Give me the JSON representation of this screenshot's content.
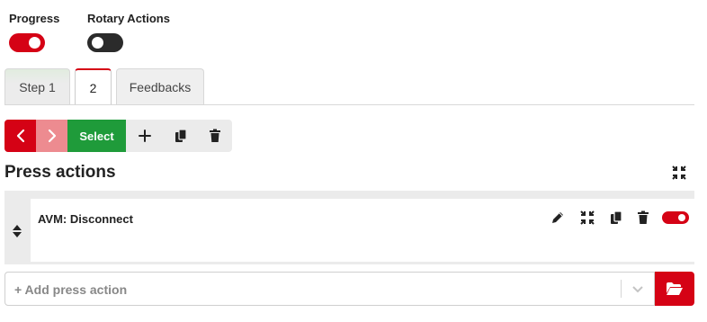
{
  "toggles": {
    "progress": {
      "label": "Progress",
      "enabled": true
    },
    "rotary_actions": {
      "label": "Rotary Actions",
      "enabled": false
    }
  },
  "tabs": [
    {
      "label": "Step 1",
      "active": false
    },
    {
      "label": "2",
      "active": true
    },
    {
      "label": "Feedbacks",
      "active": false
    }
  ],
  "step_toolbar": {
    "prev_icon": "chevron-left-icon",
    "next_icon": "chevron-right-icon",
    "select_label": "Select",
    "add_icon": "plus-icon",
    "copy_icon": "copy-icon",
    "delete_icon": "trash-icon"
  },
  "press_actions": {
    "title": "Press actions",
    "collapse_icon": "compress-icon",
    "items": [
      {
        "name": "AVM: Disconnect",
        "enabled": true,
        "icons": [
          "pencil-icon",
          "compress-icon",
          "copy-icon",
          "trash-icon"
        ]
      }
    ],
    "add_placeholder": "+ Add press action",
    "folder_icon": "folder-open-icon"
  },
  "colors": {
    "accent_red": "#d50215",
    "select_green": "#1f9b3a",
    "disabled_red": "#ed8b90",
    "toggle_off": "#2b2b2b"
  }
}
